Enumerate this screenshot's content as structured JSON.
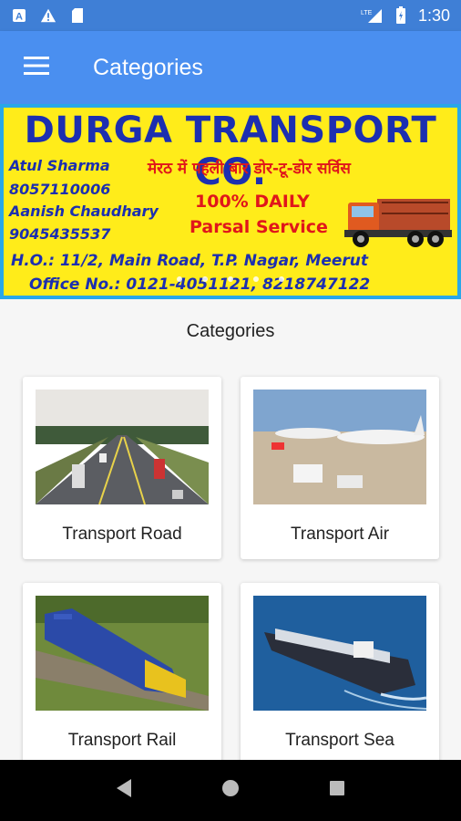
{
  "status_bar": {
    "time": "1:30",
    "network": "LTE"
  },
  "app_bar": {
    "title": "Categories"
  },
  "banner": {
    "title": "DURGA TRANSPORT CO.",
    "contact1_name": "Atul Sharma",
    "contact1_phone": "8057110006",
    "contact2_name": "Aanish Chaudhary",
    "contact2_phone": "9045435537",
    "hindi_line": "मेरठ में पहली बार डोर-टू-डोर सर्विस",
    "daily": "100%  DAILY",
    "service": "Parsal Service",
    "address": "H.O.: 11/2, Main Road, T.P. Nagar, Meerut",
    "office": "Office No.: 0121-4051121, 8218747122"
  },
  "section": {
    "title": "Categories"
  },
  "categories": [
    {
      "label": "Transport Road"
    },
    {
      "label": "Transport Air"
    },
    {
      "label": "Transport Rail"
    },
    {
      "label": "Transport Sea"
    }
  ],
  "colors": {
    "app_bar": "#4a8ff0",
    "status_bar": "#3f7fd6",
    "banner_bg": "#ffec1a",
    "banner_text": "#1c2fb0",
    "banner_accent": "#e0161b"
  }
}
